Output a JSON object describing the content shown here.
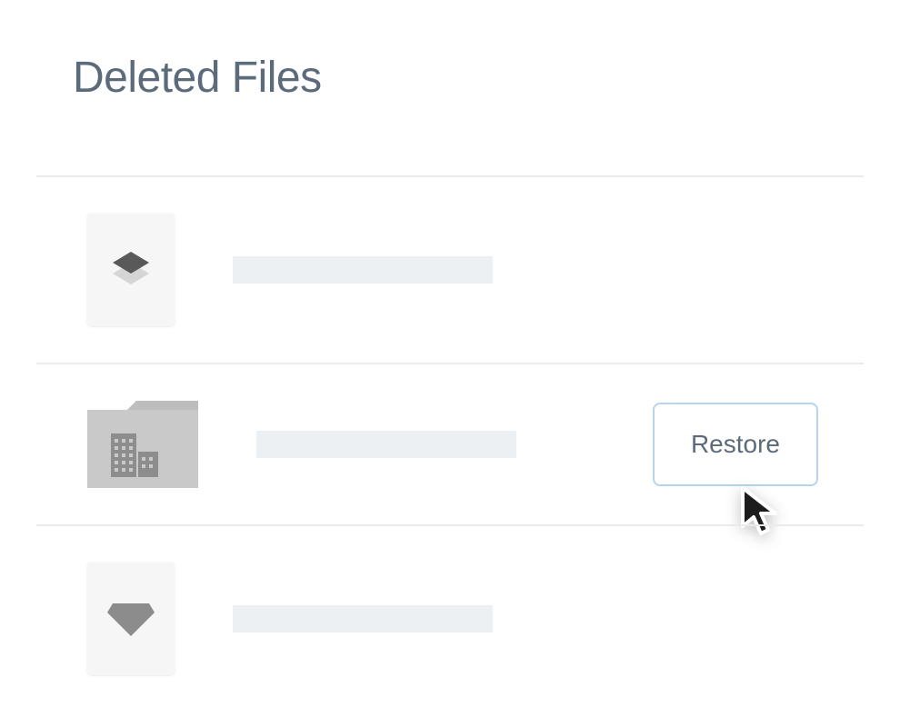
{
  "page_title": "Deleted Files",
  "restore_label": "Restore",
  "rows": [
    {
      "icon": "layers",
      "show_restore": false
    },
    {
      "icon": "building-folder",
      "show_restore": true
    },
    {
      "icon": "diamond",
      "show_restore": false
    }
  ],
  "colors": {
    "title": "#5b6b7c",
    "divider": "#e9ecef",
    "thumb_bg": "#f6f6f6",
    "placeholder": "#edf0f2",
    "restore_border": "#b7d4ee",
    "folder": "#c9c9c9",
    "folder_tab": "#bdbdbd",
    "building": "#8d8d8d",
    "layers_top": "#595959",
    "layers_bottom": "#d5d5d5",
    "diamond": "#8c8c8c"
  }
}
